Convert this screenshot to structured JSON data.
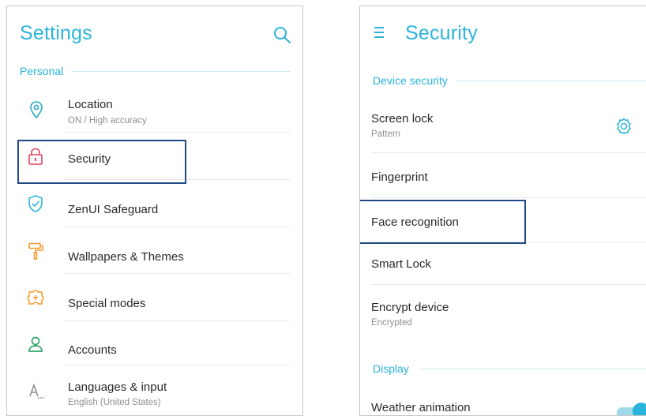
{
  "left_screen": {
    "title": "Settings",
    "section_personal": "Personal",
    "items": [
      {
        "icon": "location-pin-icon",
        "title": "Location",
        "subtitle": "ON / High accuracy"
      },
      {
        "icon": "padlock-icon",
        "title": "Security"
      },
      {
        "icon": "shield-check-icon",
        "title": "ZenUI Safeguard"
      },
      {
        "icon": "paint-roller-icon",
        "title": "Wallpapers & Themes"
      },
      {
        "icon": "puzzle-plus-icon",
        "title": "Special modes"
      },
      {
        "icon": "person-icon",
        "title": "Accounts"
      },
      {
        "icon": "language-icon",
        "title": "Languages & input",
        "subtitle": "English (United States)"
      }
    ]
  },
  "right_screen": {
    "title": "Security",
    "section_device_security": "Device security",
    "items": [
      {
        "title": "Screen lock",
        "subtitle": "Pattern",
        "icon": "gear-icon"
      },
      {
        "title": "Fingerprint"
      },
      {
        "title": "Face recognition"
      },
      {
        "title": "Smart Lock"
      },
      {
        "title": "Encrypt device",
        "subtitle": "Encrypted"
      }
    ],
    "section_display": "Display",
    "weather_animation": {
      "title": "Weather animation",
      "toggle_on": true
    }
  },
  "colors": {
    "accent": "#2bb4da",
    "highlight_box": "#1f4a86",
    "security_icon": "#e0445f",
    "location_icon": "#29a8c4",
    "safeguard_icon": "#2bb4da",
    "wallpaper_icon": "#f39a2b",
    "special_icon": "#f39a2b",
    "accounts_icon": "#2fa46a",
    "language_icon": "#8a8a8a"
  }
}
